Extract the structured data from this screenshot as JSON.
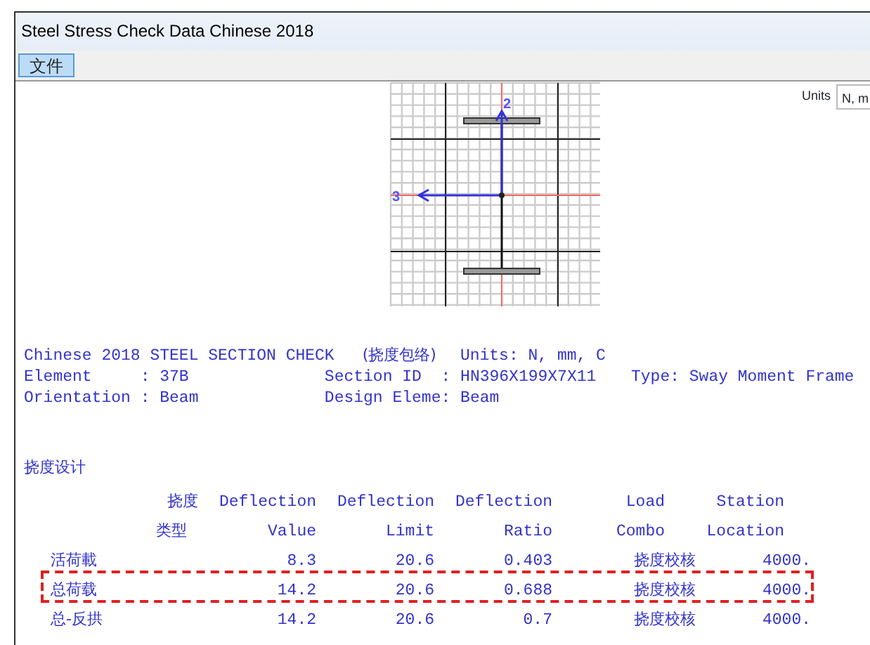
{
  "window": {
    "title": "Steel Stress Check Data  Chinese 2018"
  },
  "menu": [
    {
      "label": "文件",
      "selected": true
    }
  ],
  "units": {
    "label": "Units",
    "value": "N, m"
  },
  "section_diagram": {
    "axis_labels": [
      "2",
      "3"
    ]
  },
  "report": {
    "heading": [
      "Chinese 2018 STEEL SECTION CHECK",
      "(挠度包络)",
      "Units: N, mm, C"
    ],
    "lines": [
      [
        "Element     : 37B",
        "Section ID  : HN396X199X7X11",
        "Type: Sway Moment Frame"
      ],
      [
        "Orientation : Beam",
        "Design Eleme: Beam"
      ]
    ]
  },
  "deflection": {
    "title": "挠度设计",
    "columns": [
      {
        "line1": "挠度",
        "line2": "类型"
      },
      {
        "line1": "Deflection",
        "line2": "Value"
      },
      {
        "line1": "Deflection",
        "line2": "Limit"
      },
      {
        "line1": "Deflection",
        "line2": "Ratio"
      },
      {
        "line1": "Load",
        "line2": "Combo"
      },
      {
        "line1": "Station",
        "line2": "Location"
      }
    ],
    "rows": [
      {
        "type": "活荷載",
        "value": "8.3",
        "limit": "20.6",
        "ratio": "0.403",
        "combo": "挠度校核",
        "location": "4000.",
        "highlighted": false
      },
      {
        "type": "总荷载",
        "value": "14.2",
        "limit": "20.6",
        "ratio": "0.688",
        "combo": "挠度校核",
        "location": "4000.",
        "highlighted": true
      },
      {
        "type": "总-反拱",
        "value": "14.2",
        "limit": "20.6",
        "ratio": "0.7",
        "combo": "挠度校核",
        "location": "4000.",
        "highlighted": false
      }
    ]
  }
}
